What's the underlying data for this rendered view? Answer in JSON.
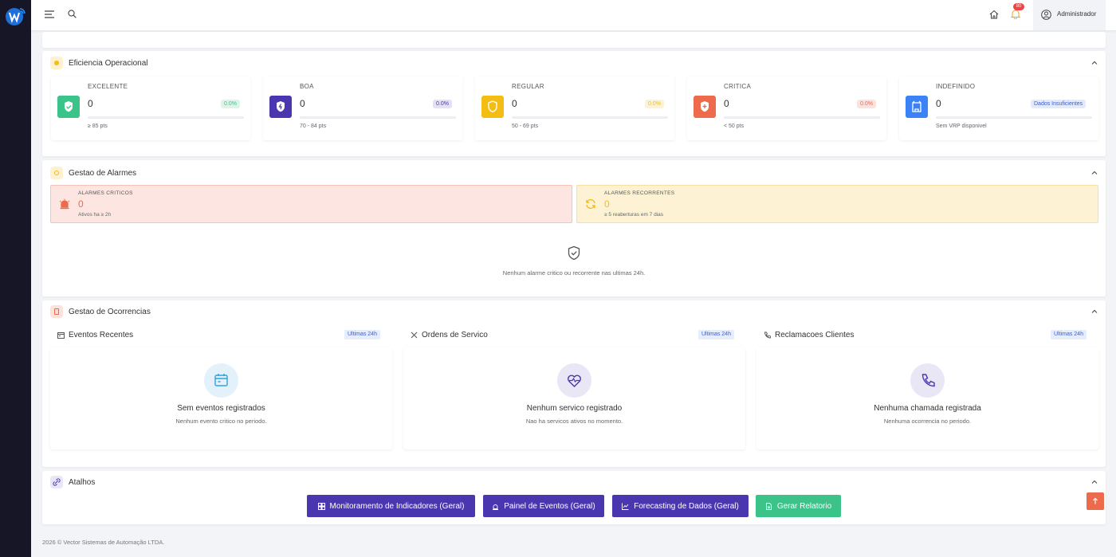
{
  "topbar": {
    "notification_count": "80",
    "user_name": "Administrador"
  },
  "eficiencia": {
    "title": "Eficiencia Operacional",
    "kpis": [
      {
        "label": "EXCELENTE",
        "value": "0",
        "pct": "0.0%",
        "range": "≥ 85 pts",
        "color": "#3cc38a"
      },
      {
        "label": "BOA",
        "value": "0",
        "pct": "0.0%",
        "range": "70 - 84 pts",
        "color": "#4a37b0"
      },
      {
        "label": "REGULAR",
        "value": "0",
        "pct": "0.0%",
        "range": "50 - 69 pts",
        "color": "#f4bd14"
      },
      {
        "label": "CRITICA",
        "value": "0",
        "pct": "0.0%",
        "range": "< 50 pts",
        "color": "#ee6a4c"
      },
      {
        "label": "INDEFINIDO",
        "value": "0",
        "pct": "Dados Insuficientes",
        "range": "Sem VRP disponivel",
        "color": "#3b82f6"
      }
    ]
  },
  "alarmes": {
    "title": "Gestao de Alarmes",
    "criticos": {
      "label": "ALARMES CRITICOS",
      "value": "0",
      "sub": "Ativos ha ≥ 2h",
      "color": "#ee6a4c"
    },
    "recorrentes": {
      "label": "ALARMES RECORRENTES",
      "value": "0",
      "sub": "≥ 5 reaberturas em 7 dias",
      "color": "#f4bd14"
    },
    "empty_message": "Nenhum alarme critico ou recorrente nas ultimas 24h."
  },
  "ocorrencias": {
    "title": "Gestao de Ocorrencias",
    "panels": [
      {
        "title": "Eventos Recentes",
        "pill": "Ultimas 24h",
        "empty_title": "Sem eventos registrados",
        "empty_sub": "Nenhum evento critico no periodo."
      },
      {
        "title": "Ordens de Servico",
        "pill": "Ultimas 24h",
        "empty_title": "Nenhum servico registrado",
        "empty_sub": "Nao ha servicos ativos no momento."
      },
      {
        "title": "Reclamacoes Clientes",
        "pill": "Ultimas 24h",
        "empty_title": "Nenhuma chamada registrada",
        "empty_sub": "Nenhuma ocorrencia no periodo."
      }
    ]
  },
  "atalhos": {
    "title": "Atalhos",
    "buttons": [
      {
        "label": "Monitoramento de Indicadores (Geral)",
        "color": "#4a37b0"
      },
      {
        "label": "Painel de Eventos (Geral)",
        "color": "#4a37b0"
      },
      {
        "label": "Forecasting de Dados (Geral)",
        "color": "#4a37b0"
      },
      {
        "label": "Gerar Relatorio",
        "color": "#3cc38a"
      }
    ]
  },
  "footer": {
    "text": "2026 © Vector Sistemas de Automação LTDA."
  }
}
